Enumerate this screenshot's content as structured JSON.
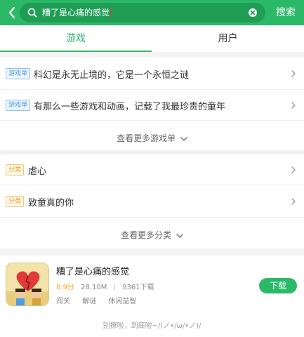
{
  "header": {
    "search_query": "糟了是心痛的感觉",
    "search_button_label": "搜索",
    "accent_color": "#2bb968"
  },
  "tabs": [
    {
      "label": "游戏",
      "active": true
    },
    {
      "label": "用户",
      "active": false
    }
  ],
  "game_lists": {
    "tag": "游戏单",
    "items": [
      {
        "title": "科幻是永无止境的，它是一个永恒之谜"
      },
      {
        "title": "有那么一些游戏和动画，记载了我最珍贵的童年"
      }
    ],
    "more_label": "查看更多游戏单"
  },
  "categories": {
    "tag": "分类",
    "items": [
      {
        "title": "虐心"
      },
      {
        "title": "致童真的你"
      }
    ],
    "more_label": "查看更多分类"
  },
  "app": {
    "name": "糟了是心痛的感觉",
    "rating": "8.9分",
    "size": "28.10M",
    "downloads": "9361下载",
    "tags": [
      "闯关",
      "解谜",
      "休闲益智"
    ],
    "download_label": "下载",
    "icon": "game-cover-icon"
  },
  "footer": {
    "end_note": "别撩啦，到底啦~/(ノ•/ω/•ノ)/"
  }
}
